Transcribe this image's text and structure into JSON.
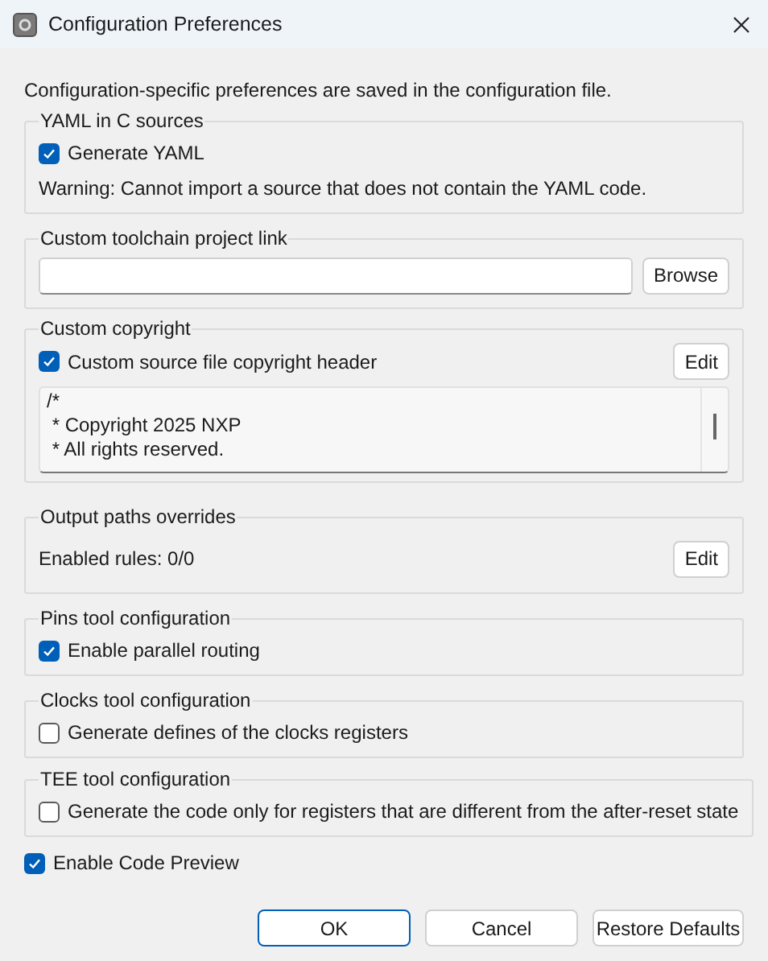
{
  "window": {
    "title": "Configuration Preferences"
  },
  "intro": "Configuration-specific preferences are saved in the configuration file.",
  "groups": [
    {
      "title": "YAML in C sources",
      "items": [
        {
          "kind": "checkbox",
          "label": "Generate YAML",
          "checked": true
        },
        {
          "kind": "text",
          "text": "Warning: Cannot import a source that does not contain the YAML code."
        }
      ]
    },
    {
      "title": "Custom toolchain project link",
      "items": [
        {
          "kind": "path",
          "button": "Browse"
        }
      ]
    },
    {
      "title": "Custom copyright",
      "items": [
        {
          "kind": "checkbox",
          "label": "Custom source file copyright header",
          "checked": true,
          "button": "Edit"
        },
        {
          "kind": "textarea",
          "lines": [
            "/*",
            " * Copyright 2025 NXP",
            " * All rights reserved."
          ]
        }
      ]
    },
    {
      "title": "Output paths overrides",
      "items": [
        {
          "kind": "text",
          "text": "Enabled rules: 0/0",
          "button": "Edit"
        }
      ]
    },
    {
      "title": "Pins tool configuration",
      "items": [
        {
          "kind": "checkbox",
          "label": "Enable parallel routing",
          "checked": true
        }
      ]
    },
    {
      "title": "Clocks tool configuration",
      "items": [
        {
          "kind": "checkbox",
          "label": "Generate defines of the clocks registers",
          "checked": false
        }
      ]
    },
    {
      "title": "TEE tool configuration",
      "items": [
        {
          "kind": "checkbox",
          "label": "Generate the code only for registers that are different from the after-reset state",
          "checked": false
        }
      ]
    }
  ],
  "code_preview": {
    "label": "Enable Code Preview",
    "checked": true
  },
  "buttons": [
    {
      "label": "OK",
      "default": true
    },
    {
      "label": "Cancel",
      "default": false
    },
    {
      "label": "Restore Defaults",
      "default": false
    }
  ]
}
